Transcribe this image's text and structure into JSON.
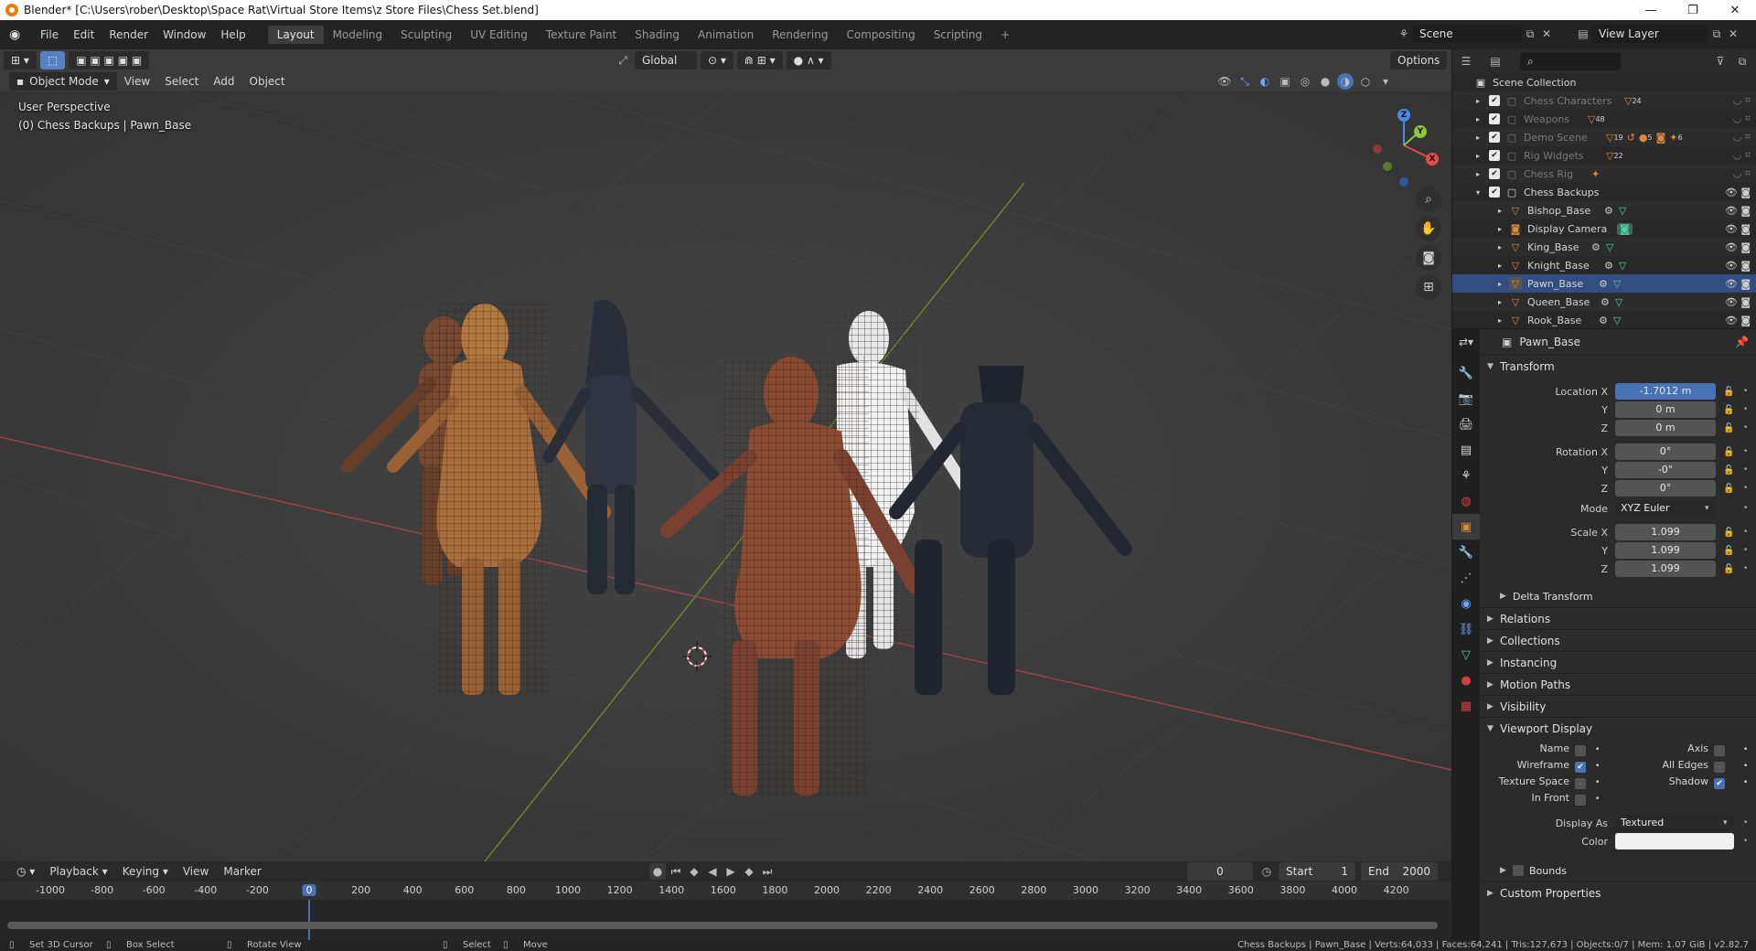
{
  "window": {
    "title": "Blender* [C:\\Users\\rober\\Desktop\\Space Rat\\Virtual Store Items\\z Store Files\\Chess Set.blend]",
    "buttons": [
      "—",
      "❐",
      "✕"
    ]
  },
  "topbar": {
    "menus": [
      "File",
      "Edit",
      "Render",
      "Window",
      "Help"
    ],
    "workspaces": [
      "Layout",
      "Modeling",
      "Sculpting",
      "UV Editing",
      "Texture Paint",
      "Shading",
      "Animation",
      "Rendering",
      "Compositing",
      "Scripting"
    ],
    "active_workspace": "Layout",
    "add_tab": "+",
    "scene": "Scene",
    "view_layer": "View Layer"
  },
  "viewport": {
    "transform_orientation": "Global",
    "options_label": "Options",
    "mode": "Object Mode",
    "menus": [
      "View",
      "Select",
      "Add",
      "Object"
    ],
    "perspective_label": "User Perspective",
    "context_label": "(0) Chess Backups | Pawn_Base",
    "gizmo": {
      "x": "X",
      "y": "Y",
      "z": "Z"
    }
  },
  "outliner": {
    "root": "Scene Collection",
    "collections": [
      {
        "name": "Chess Characters",
        "count": "24",
        "dim": true
      },
      {
        "name": "Weapons",
        "count": "48",
        "dim": true
      },
      {
        "name": "Demo Scene",
        "count": "19",
        "extra": "5",
        "extra2": "6",
        "dim": true
      },
      {
        "name": "Rig Widgets",
        "count": "22",
        "dim": true
      },
      {
        "name": "Chess Rig",
        "count": "",
        "dim": true
      },
      {
        "name": "Chess Backups",
        "count": "",
        "dim": false
      }
    ],
    "objects": [
      "Bishop_Base",
      "Display Camera",
      "King_Base",
      "Knight_Base",
      "Pawn_Base",
      "Queen_Base",
      "Rook_Base"
    ],
    "active_object": "Pawn_Base"
  },
  "properties": {
    "object_name": "Pawn_Base",
    "transform": {
      "title": "Transform",
      "location_label": "Location X",
      "location": [
        "-1.7012 m",
        "0 m",
        "0 m"
      ],
      "rotation_label": "Rotation X",
      "rotation": [
        "0°",
        "-0°",
        "0°"
      ],
      "mode_label": "Mode",
      "mode": "XYZ Euler",
      "scale_label": "Scale X",
      "scale": [
        "1.099",
        "1.099",
        "1.099"
      ],
      "axis_y": "Y",
      "axis_z": "Z"
    },
    "delta_transform": "Delta Transform",
    "collapsed_panels": [
      "Relations",
      "Collections",
      "Instancing",
      "Motion Paths",
      "Visibility"
    ],
    "viewport_display": {
      "title": "Viewport Display",
      "name": "Name",
      "axis": "Axis",
      "wireframe": "Wireframe",
      "all_edges": "All Edges",
      "texture_space": "Texture Space",
      "shadow": "Shadow",
      "in_front": "In Front",
      "display_as_label": "Display As",
      "display_as": "Textured",
      "color_label": "Color",
      "bounds": "Bounds"
    },
    "custom_properties": "Custom Properties"
  },
  "timeline": {
    "menus": [
      "Playback",
      "Keying",
      "View",
      "Marker"
    ],
    "current_frame": "0",
    "start_label": "Start",
    "start": "1",
    "end_label": "End",
    "end": "2000",
    "ticks": [
      "-1000",
      "-800",
      "-600",
      "-400",
      "-200",
      "0",
      "200",
      "400",
      "600",
      "800",
      "1000",
      "1200",
      "1400",
      "1600",
      "1800",
      "2000",
      "2200",
      "2400",
      "2600",
      "2800",
      "3000",
      "3200",
      "3400",
      "3600",
      "3800",
      "4000",
      "4200"
    ]
  },
  "statusbar": {
    "hint1": "Set 3D Cursor",
    "hint2": "Box Select",
    "hint3": "Rotate View",
    "hint4": "Select",
    "hint5": "Move",
    "stats": "Chess Backups | Pawn_Base | Verts:64,033 | Faces:64,241 | Tris:127,673 | Objects:0/7 | Mem: 1.07 GiB | v2.82.7"
  },
  "colors": {
    "accent": "#4772b3",
    "x_axis": "#e84a4a",
    "y_axis": "#8cc63f",
    "z_axis": "#4a8be8",
    "bg": "#3b3b3b"
  }
}
